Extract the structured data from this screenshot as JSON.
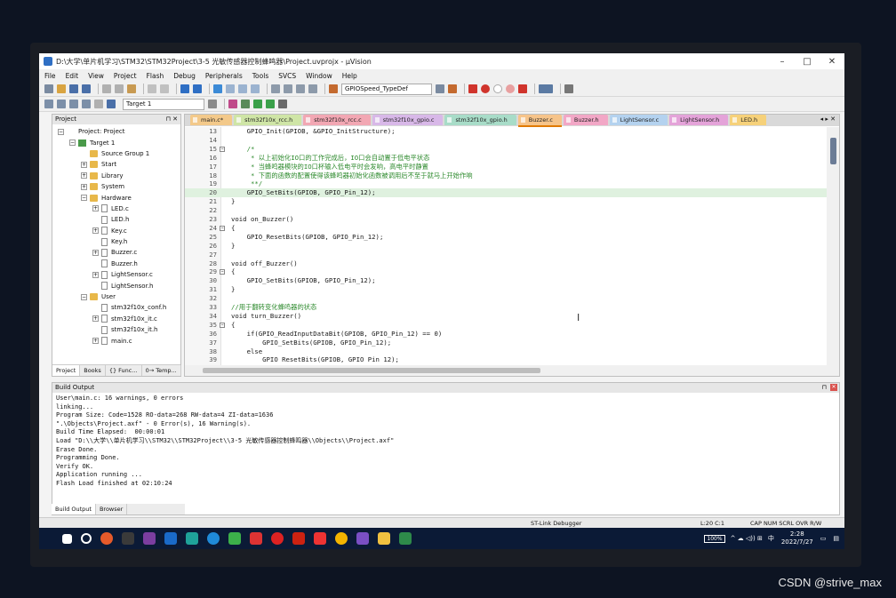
{
  "window": {
    "title": "D:\\大学\\单片机学习\\STM32\\STM32Project\\3-5 光敏传感器控制蜂鸣器\\Project.uvprojx - µVision",
    "minimize": "–",
    "maximize": "□",
    "close": "✕"
  },
  "menu": [
    "File",
    "Edit",
    "View",
    "Project",
    "Flash",
    "Debug",
    "Peripherals",
    "Tools",
    "SVCS",
    "Window",
    "Help"
  ],
  "toolbar": {
    "find_combo": "GPIOSpeed_TypeDef",
    "target_combo": "Target 1"
  },
  "project_panel": {
    "title": "Project",
    "pin": "⊓ ✕",
    "tree": [
      {
        "label": "Project: Project",
        "level": 0,
        "icon": "project-icon",
        "exp": "−"
      },
      {
        "label": "Target 1",
        "level": 1,
        "icon": "target-icon",
        "exp": "−"
      },
      {
        "label": "Source Group 1",
        "level": 2,
        "icon": "folder-icon",
        "exp": ""
      },
      {
        "label": "Start",
        "level": 2,
        "icon": "folder-icon",
        "exp": "+"
      },
      {
        "label": "Library",
        "level": 2,
        "icon": "folder-icon",
        "exp": "+"
      },
      {
        "label": "System",
        "level": 2,
        "icon": "folder-icon",
        "exp": "+"
      },
      {
        "label": "Hardware",
        "level": 2,
        "icon": "folder-icon",
        "exp": "−"
      },
      {
        "label": "LED.c",
        "level": 3,
        "icon": "file-icon",
        "exp": "+"
      },
      {
        "label": "LED.h",
        "level": 3,
        "icon": "file-icon",
        "exp": ""
      },
      {
        "label": "Key.c",
        "level": 3,
        "icon": "file-icon",
        "exp": "+"
      },
      {
        "label": "Key.h",
        "level": 3,
        "icon": "file-icon",
        "exp": ""
      },
      {
        "label": "Buzzer.c",
        "level": 3,
        "icon": "file-icon",
        "exp": "+"
      },
      {
        "label": "Buzzer.h",
        "level": 3,
        "icon": "file-icon",
        "exp": ""
      },
      {
        "label": "LightSensor.c",
        "level": 3,
        "icon": "file-icon",
        "exp": "+"
      },
      {
        "label": "LightSensor.h",
        "level": 3,
        "icon": "file-icon",
        "exp": ""
      },
      {
        "label": "User",
        "level": 2,
        "icon": "folder-icon",
        "exp": "−"
      },
      {
        "label": "stm32f10x_conf.h",
        "level": 3,
        "icon": "file-icon",
        "exp": ""
      },
      {
        "label": "stm32f10x_it.c",
        "level": 3,
        "icon": "file-icon",
        "exp": "+"
      },
      {
        "label": "stm32f10x_it.h",
        "level": 3,
        "icon": "file-icon",
        "exp": ""
      },
      {
        "label": "main.c",
        "level": 3,
        "icon": "file-icon",
        "exp": "+"
      }
    ],
    "tabs": [
      "Project",
      "Books",
      "{} Func...",
      "0→ Temp..."
    ]
  },
  "editor": {
    "tabs": [
      {
        "label": "main.c*",
        "color": "#f3c98a"
      },
      {
        "label": "stm32f10x_rcc.h",
        "color": "#cfe5a6"
      },
      {
        "label": "stm32f10x_rcc.c",
        "color": "#f2a7b3"
      },
      {
        "label": "stm32f10x_gpio.c",
        "color": "#d8b8e8"
      },
      {
        "label": "stm32f10x_gpio.h",
        "color": "#a8dcc8"
      },
      {
        "label": "Buzzer.c",
        "color": "#f6c48a"
      },
      {
        "label": "Buzzer.h",
        "color": "#f2a7c6"
      },
      {
        "label": "LightSensor.c",
        "color": "#b4d2ef"
      },
      {
        "label": "LightSensor.h",
        "color": "#e4a3d9"
      },
      {
        "label": "LED.h",
        "color": "#f6d17a"
      }
    ],
    "tab_controls": "◂ ▸ ✕",
    "active_tab": "Buzzer.c",
    "lines": [
      {
        "n": "13",
        "fold": "",
        "code": "    GPIO_Init(GPIOB, &GPIO_InitStructure);",
        "type": ""
      },
      {
        "n": "14",
        "fold": "",
        "code": "",
        "type": ""
      },
      {
        "n": "15",
        "fold": "−",
        "code": "    /*",
        "type": "cmt"
      },
      {
        "n": "16",
        "fold": "",
        "code": "     * 以上初始化IO口的工作完成后，IO口会自动置于低电平状态",
        "type": "cmt"
      },
      {
        "n": "17",
        "fold": "",
        "code": "     * 当蜂鸣器模块的IO口杯输入低电平时会发响，高电平时静置",
        "type": "cmt"
      },
      {
        "n": "18",
        "fold": "",
        "code": "     * 下面的函数的配置使得该蜂鸣器初始化函数被调用后不至于就马上开始作响",
        "type": "cmt"
      },
      {
        "n": "19",
        "fold": "",
        "code": "     **/",
        "type": "cmt"
      },
      {
        "n": "20",
        "fold": "",
        "code": "    GPIO_SetBits(GPIOB, GPIO_Pin_12);",
        "type": "hl"
      },
      {
        "n": "21",
        "fold": "",
        "code": "}",
        "type": ""
      },
      {
        "n": "22",
        "fold": "",
        "code": "",
        "type": ""
      },
      {
        "n": "23",
        "fold": "",
        "code": "void on_Buzzer()",
        "type": ""
      },
      {
        "n": "24",
        "fold": "−",
        "code": "{",
        "type": ""
      },
      {
        "n": "25",
        "fold": "",
        "code": "    GPIO_ResetBits(GPIOB, GPIO_Pin_12);",
        "type": ""
      },
      {
        "n": "26",
        "fold": "",
        "code": "}",
        "type": ""
      },
      {
        "n": "27",
        "fold": "",
        "code": "",
        "type": ""
      },
      {
        "n": "28",
        "fold": "",
        "code": "void off_Buzzer()",
        "type": ""
      },
      {
        "n": "29",
        "fold": "−",
        "code": "{",
        "type": ""
      },
      {
        "n": "30",
        "fold": "",
        "code": "    GPIO_SetBits(GPIOB, GPIO_Pin_12);",
        "type": ""
      },
      {
        "n": "31",
        "fold": "",
        "code": "}",
        "type": ""
      },
      {
        "n": "32",
        "fold": "",
        "code": "",
        "type": ""
      },
      {
        "n": "33",
        "fold": "",
        "code": "//用于翻转变化蜂鸣器的状态",
        "type": "cmt"
      },
      {
        "n": "34",
        "fold": "",
        "code": "void turn_Buzzer()",
        "type": ""
      },
      {
        "n": "35",
        "fold": "−",
        "code": "{",
        "type": ""
      },
      {
        "n": "36",
        "fold": "",
        "code": "    if(GPIO_ReadInputDataBit(GPIOB, GPIO_Pin_12) == 0)",
        "type": ""
      },
      {
        "n": "37",
        "fold": "",
        "code": "        GPIO_SetBits(GPIOB, GPIO_Pin_12);",
        "type": ""
      },
      {
        "n": "38",
        "fold": "",
        "code": "    else",
        "type": ""
      },
      {
        "n": "39",
        "fold": "",
        "code": "        GPIO ResetBits(GPIOB, GPIO Pin 12);",
        "type": ""
      }
    ]
  },
  "build_output": {
    "title": "Build Output",
    "lines": [
      "User\\main.c: 16 warnings, 0 errors",
      "linking...",
      "Program Size: Code=1528 RO-data=268 RW-data=4 ZI-data=1636",
      "\".\\Objects\\Project.axf\" - 0 Error(s), 16 Warning(s).",
      "Build Time Elapsed:  00:00:01",
      "Load \"D:\\\\大学\\\\单片机学习\\\\STM32\\\\STM32Project\\\\3-5 光敏传感器控制蜂鸣器\\\\Objects\\\\Project.axf\"",
      "Erase Done.",
      "Programming Done.",
      "Verify OK.",
      "Application running ...",
      "Flash Load finished at 02:10:24"
    ],
    "tabs": [
      "Build Output",
      "Browser"
    ]
  },
  "status": {
    "debugger": "ST-Link Debugger",
    "position": "L:20 C:1",
    "flags": "CAP  NUM  SCRL  OVR  R/W"
  },
  "taskbar": {
    "battery": "100%",
    "ime": "中",
    "time": "2:28",
    "date": "2022/7/27"
  },
  "watermark": "CSDN @strive_max"
}
